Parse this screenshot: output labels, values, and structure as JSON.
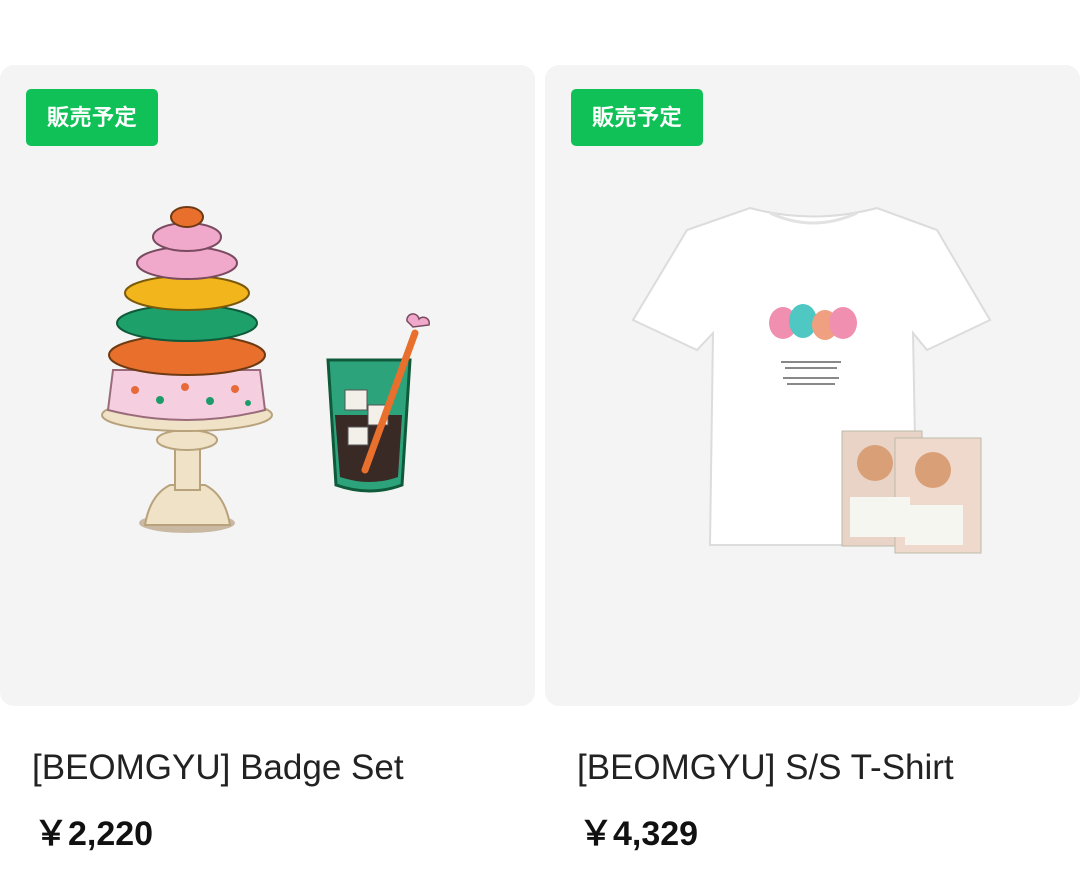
{
  "products": [
    {
      "badge": "販売予定",
      "title": "[BEOMGYU] Badge Set",
      "price": "￥2,220",
      "image_icon": "macaron-tower-and-iced-drink-badge"
    },
    {
      "badge": "販売予定",
      "title": "[BEOMGYU] S/S T-Shirt",
      "price": "￥4,329",
      "image_icon": "white-tshirt-with-macarons-and-photocards"
    }
  ],
  "colors": {
    "badge_bg": "#10c157",
    "card_bg": "#f4f4f4",
    "text": "#222222"
  }
}
